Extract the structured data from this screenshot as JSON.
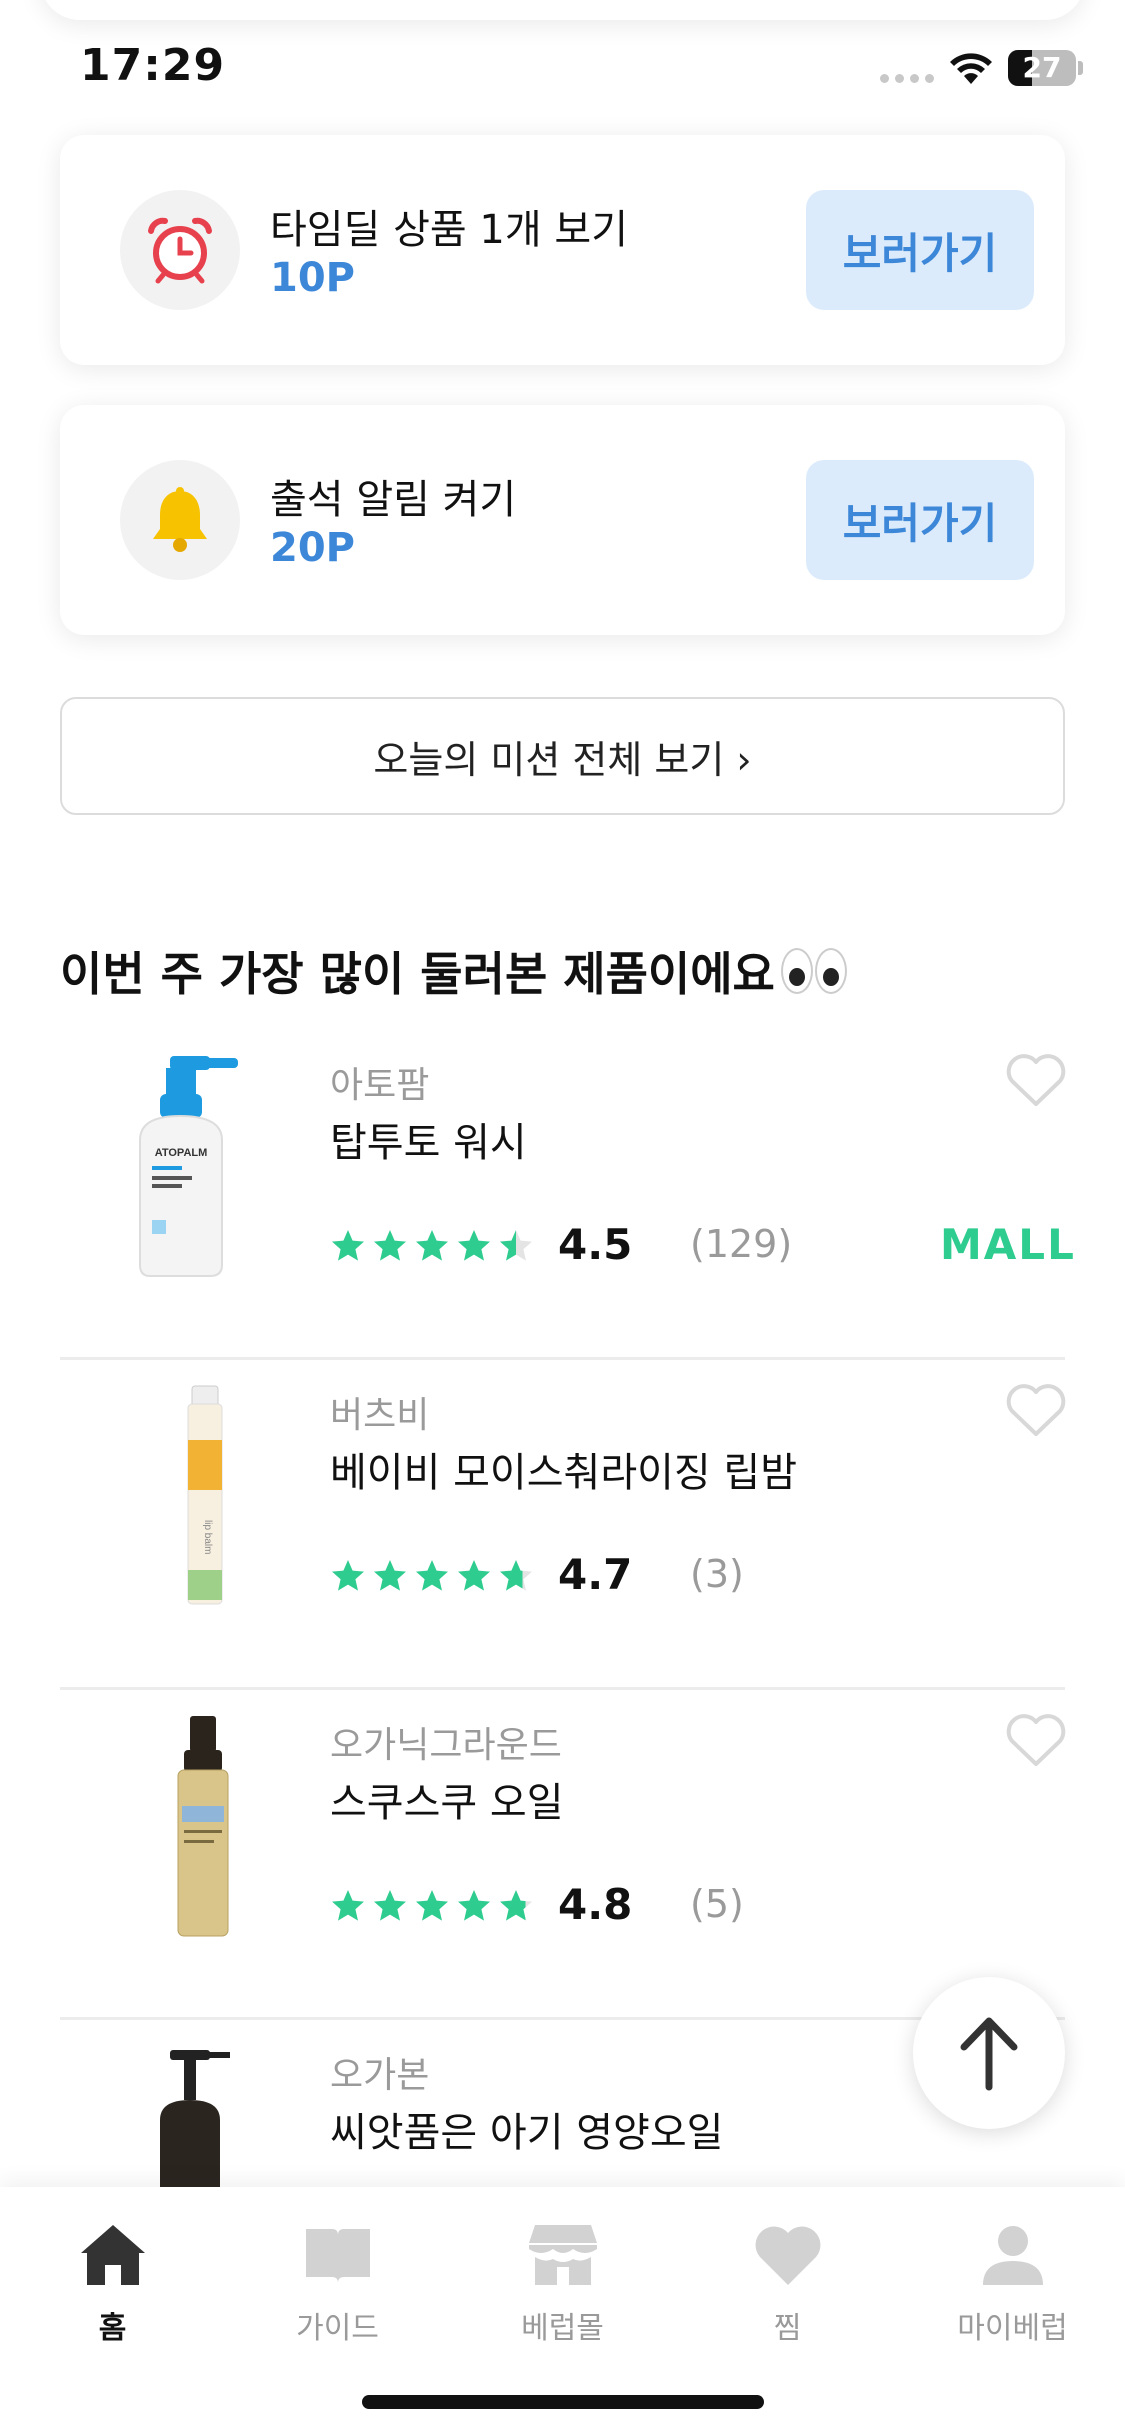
{
  "status_bar": {
    "time": "17:29",
    "battery": "27"
  },
  "missions": [
    {
      "title": "타임딜 상품 1개 보기",
      "points": "10P",
      "button": "보러가기",
      "icon": "alarm-clock-icon"
    },
    {
      "title": "출석 알림 켜기",
      "points": "20P",
      "button": "보러가기",
      "icon": "bell-icon"
    }
  ],
  "all_missions_label": "오늘의 미션 전체 보기 ›",
  "section_title": "이번 주 가장 많이 둘러본 제품이에요",
  "products": [
    {
      "brand": "아토팜",
      "name": "탑투토 워시",
      "rating": "4.5",
      "reviews": "(129)",
      "stars_value": 4.5,
      "badge": "MALL"
    },
    {
      "brand": "버츠비",
      "name": "베이비 모이스춰라이징 립밤",
      "rating": "4.7",
      "reviews": "(3)",
      "stars_value": 4.7
    },
    {
      "brand": "오가닉그라운드",
      "name": "스쿠스쿠 오일",
      "rating": "4.8",
      "reviews": "(5)",
      "stars_value": 4.8
    },
    {
      "brand": "오가본",
      "name": "씨앗품은 아기 영양오일"
    }
  ],
  "tabs": [
    {
      "label": "홈",
      "icon": "home-icon",
      "active": true
    },
    {
      "label": "가이드",
      "icon": "book-icon"
    },
    {
      "label": "베럽몰",
      "icon": "store-icon"
    },
    {
      "label": "찜",
      "icon": "heart-icon"
    },
    {
      "label": "마이베럽",
      "icon": "person-icon"
    }
  ],
  "colors": {
    "accent": "#3d87d8",
    "accent_bg": "#dcebfb",
    "star": "#2ecc8f",
    "muted": "#9a9a9a"
  }
}
